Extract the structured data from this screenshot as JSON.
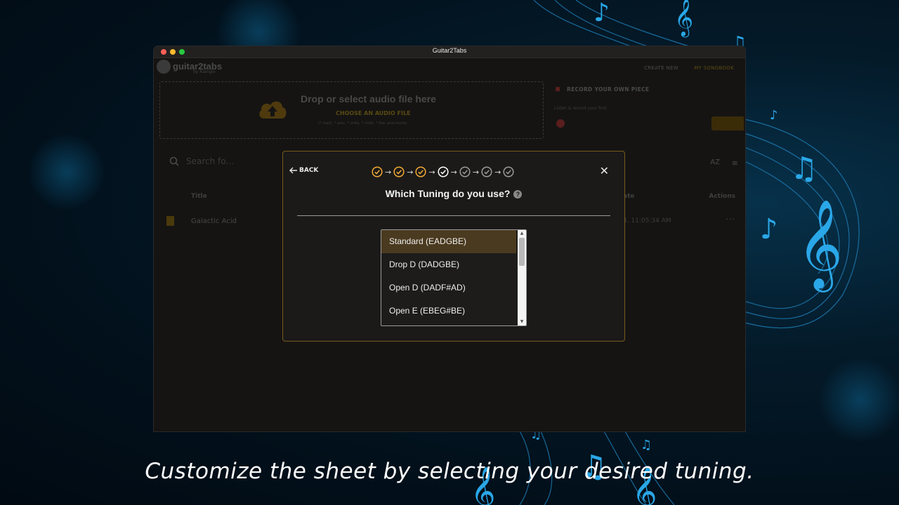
{
  "window": {
    "title": "Guitar2Tabs"
  },
  "header": {
    "logo_text": "guitar2tabs",
    "logo_sub": "by Klangio",
    "nav_create": "CREATE NEW",
    "nav_my": "MY SONGBOOK"
  },
  "upload": {
    "title": "Drop or select audio file here",
    "choose_label": "CHOOSE AN AUDIO FILE",
    "formats": "(*.mp3, *.wav, *.m4a, *.midi, *.flac and more)"
  },
  "record": {
    "title": "RECORD YOUR OWN PIECE",
    "subtitle": "Listen & record your first"
  },
  "search": {
    "placeholder": "Search fo..."
  },
  "sort": {
    "az_label": "AZ"
  },
  "table": {
    "col_title": "Title",
    "col_date": "ate",
    "col_actions": "Actions",
    "rows": [
      {
        "title": "Galactic Acid",
        "date": "4, 11:05:34 AM"
      }
    ]
  },
  "modal": {
    "back_label": "BACK",
    "question": "Which Tuning do you use?",
    "steps": [
      "completed",
      "completed",
      "completed",
      "current",
      "pending",
      "pending",
      "pending"
    ],
    "tunings": [
      "Standard (EADGBE)",
      "Drop D (DADGBE)",
      "Open D (DADF#AD)",
      "Open E (EBEG#BE)"
    ],
    "selected_tuning": "Standard (EADGBE)"
  },
  "colors": {
    "accent": "#f2a933",
    "modal_border": "#7a5a1a",
    "selected_bg": "#4a3a1f",
    "step_done": "#f2a933",
    "step_current": "#ffffff",
    "step_pending": "#9a9a9a"
  },
  "caption": "Customize the sheet by selecting your desired tuning."
}
